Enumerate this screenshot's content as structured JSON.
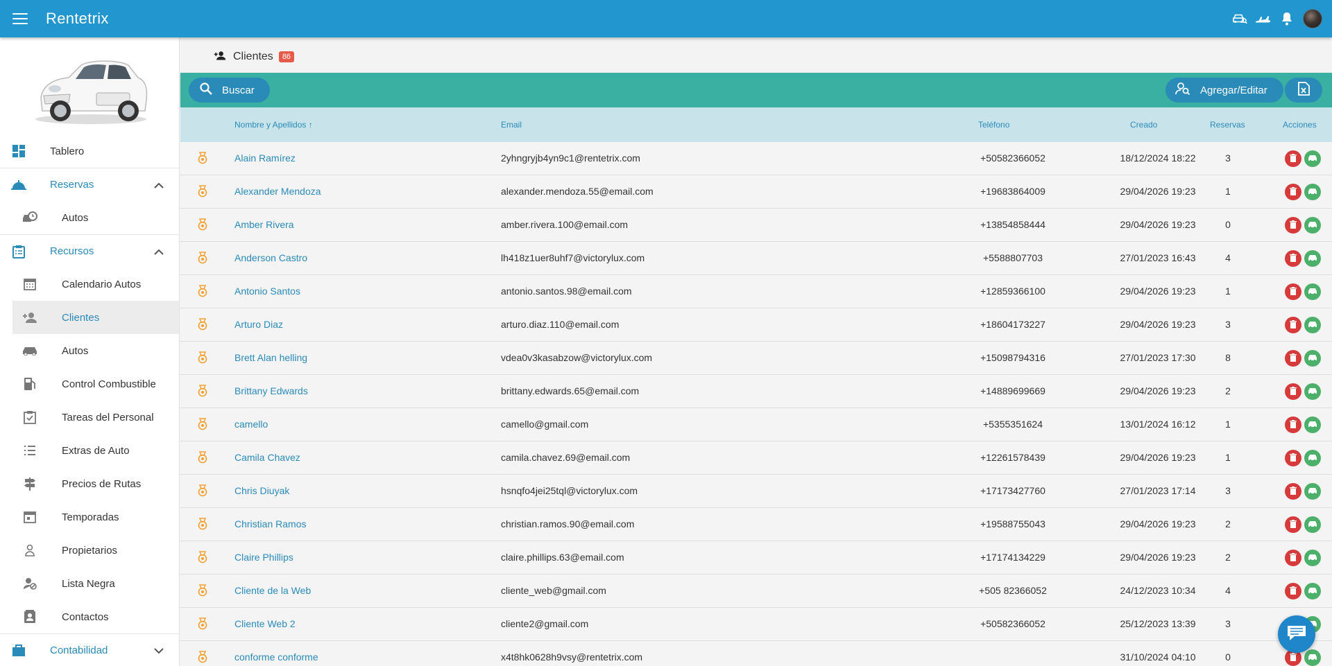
{
  "app": {
    "title": "Rentetrix"
  },
  "topbar": {
    "icons": [
      "car-search-icon",
      "airplane-icon",
      "bell-icon"
    ],
    "avatar": "user-avatar"
  },
  "sidebar": {
    "items": [
      {
        "label": "Tablero",
        "icon": "dashboard-icon"
      },
      {
        "label": "Reservas",
        "icon": "bell-service-icon",
        "section": true,
        "expanded": true
      },
      {
        "label": "Autos",
        "icon": "car-clock-icon"
      },
      {
        "label": "Recursos",
        "icon": "clipboard-icon",
        "section": true,
        "expanded": true
      },
      {
        "label": "Calendario Autos",
        "icon": "calendar-icon"
      },
      {
        "label": "Clientes",
        "icon": "add-person-icon",
        "active": true
      },
      {
        "label": "Autos",
        "icon": "car-icon"
      },
      {
        "label": "Control Combustible",
        "icon": "fuel-icon"
      },
      {
        "label": "Tareas del Personal",
        "icon": "task-clipboard-icon"
      },
      {
        "label": "Extras de Auto",
        "icon": "list-icon"
      },
      {
        "label": "Precios de Rutas",
        "icon": "signpost-icon"
      },
      {
        "label": "Temporadas",
        "icon": "calendar-season-icon"
      },
      {
        "label": "Propietarios",
        "icon": "owner-icon"
      },
      {
        "label": "Lista Negra",
        "icon": "person-block-icon"
      },
      {
        "label": "Contactos",
        "icon": "contact-card-icon"
      },
      {
        "label": "Contabilidad",
        "icon": "accounting-icon",
        "section": true,
        "expanded": false
      }
    ]
  },
  "page": {
    "title": "Clientes",
    "count": "86"
  },
  "toolbar": {
    "search_label": "Buscar",
    "add_label": "Agregar/Editar",
    "export_icon": "excel-export-icon"
  },
  "table": {
    "headers": {
      "name": "Nombre y Apellidos",
      "email": "Email",
      "phone": "Teléfono",
      "created": "Creado",
      "reservations": "Reservas",
      "actions": "Acciones"
    },
    "sort": {
      "column": "name",
      "direction": "asc"
    },
    "rows": [
      {
        "name": "Alain Ramírez",
        "email": "2yhngryjb4yn9c1@rentetrix.com",
        "phone": "+50582366052",
        "created": "18/12/2024 18:22",
        "reservations": "3"
      },
      {
        "name": "Alexander Mendoza",
        "email": "alexander.mendoza.55@email.com",
        "phone": "+19683864009",
        "created": "29/04/2026 19:23",
        "reservations": "1"
      },
      {
        "name": "Amber Rivera",
        "email": "amber.rivera.100@email.com",
        "phone": "+13854858444",
        "created": "29/04/2026 19:23",
        "reservations": "0"
      },
      {
        "name": "Anderson Castro",
        "email": "lh418z1uer8uhf7@victorylux.com",
        "phone": "+5588807703",
        "created": "27/01/2023 16:43",
        "reservations": "4"
      },
      {
        "name": "Antonio Santos",
        "email": "antonio.santos.98@email.com",
        "phone": "+12859366100",
        "created": "29/04/2026 19:23",
        "reservations": "1"
      },
      {
        "name": "Arturo Diaz",
        "email": "arturo.diaz.110@email.com",
        "phone": "+18604173227",
        "created": "29/04/2026 19:23",
        "reservations": "3"
      },
      {
        "name": "Brett Alan helling",
        "email": "vdea0v3kasabzow@victorylux.com",
        "phone": "+15098794316",
        "created": "27/01/2023 17:30",
        "reservations": "8"
      },
      {
        "name": "Brittany Edwards",
        "email": "brittany.edwards.65@email.com",
        "phone": "+14889699669",
        "created": "29/04/2026 19:23",
        "reservations": "2"
      },
      {
        "name": "camello",
        "email": "camello@gmail.com",
        "phone": "+5355351624",
        "created": "13/01/2024 16:12",
        "reservations": "1"
      },
      {
        "name": "Camila Chavez",
        "email": "camila.chavez.69@email.com",
        "phone": "+12261578439",
        "created": "29/04/2026 19:23",
        "reservations": "1"
      },
      {
        "name": "Chris Diuyak",
        "email": "hsnqfo4jei25tql@victorylux.com",
        "phone": "+17173427760",
        "created": "27/01/2023 17:14",
        "reservations": "3"
      },
      {
        "name": "Christian Ramos",
        "email": "christian.ramos.90@email.com",
        "phone": "+19588755043",
        "created": "29/04/2026 19:23",
        "reservations": "2"
      },
      {
        "name": "Claire Phillips",
        "email": "claire.phillips.63@email.com",
        "phone": "+17174134229",
        "created": "29/04/2026 19:23",
        "reservations": "2"
      },
      {
        "name": "Cliente de la Web",
        "email": "cliente_web@gmail.com",
        "phone": "+505 82366052",
        "created": "24/12/2023 10:34",
        "reservations": "4"
      },
      {
        "name": "Cliente Web 2",
        "email": "cliente2@gmail.com",
        "phone": "+50582366052",
        "created": "25/12/2023 13:39",
        "reservations": "3"
      },
      {
        "name": "conforme conforme",
        "email": "x4t8hk0628h9vsy@rentetrix.com",
        "phone": "",
        "created": "31/10/2024 04:10",
        "reservations": "0"
      }
    ]
  },
  "colors": {
    "topbar": "#2196cf",
    "toolbar": "#3ab0a2",
    "accent": "#2a8ab8",
    "badge": "#e65a4a",
    "delete": "#d63a3a",
    "car_action": "#4caf6a",
    "medal": "#f0a030"
  },
  "chat_widget": {
    "icon": "chat-bubble-icon"
  }
}
